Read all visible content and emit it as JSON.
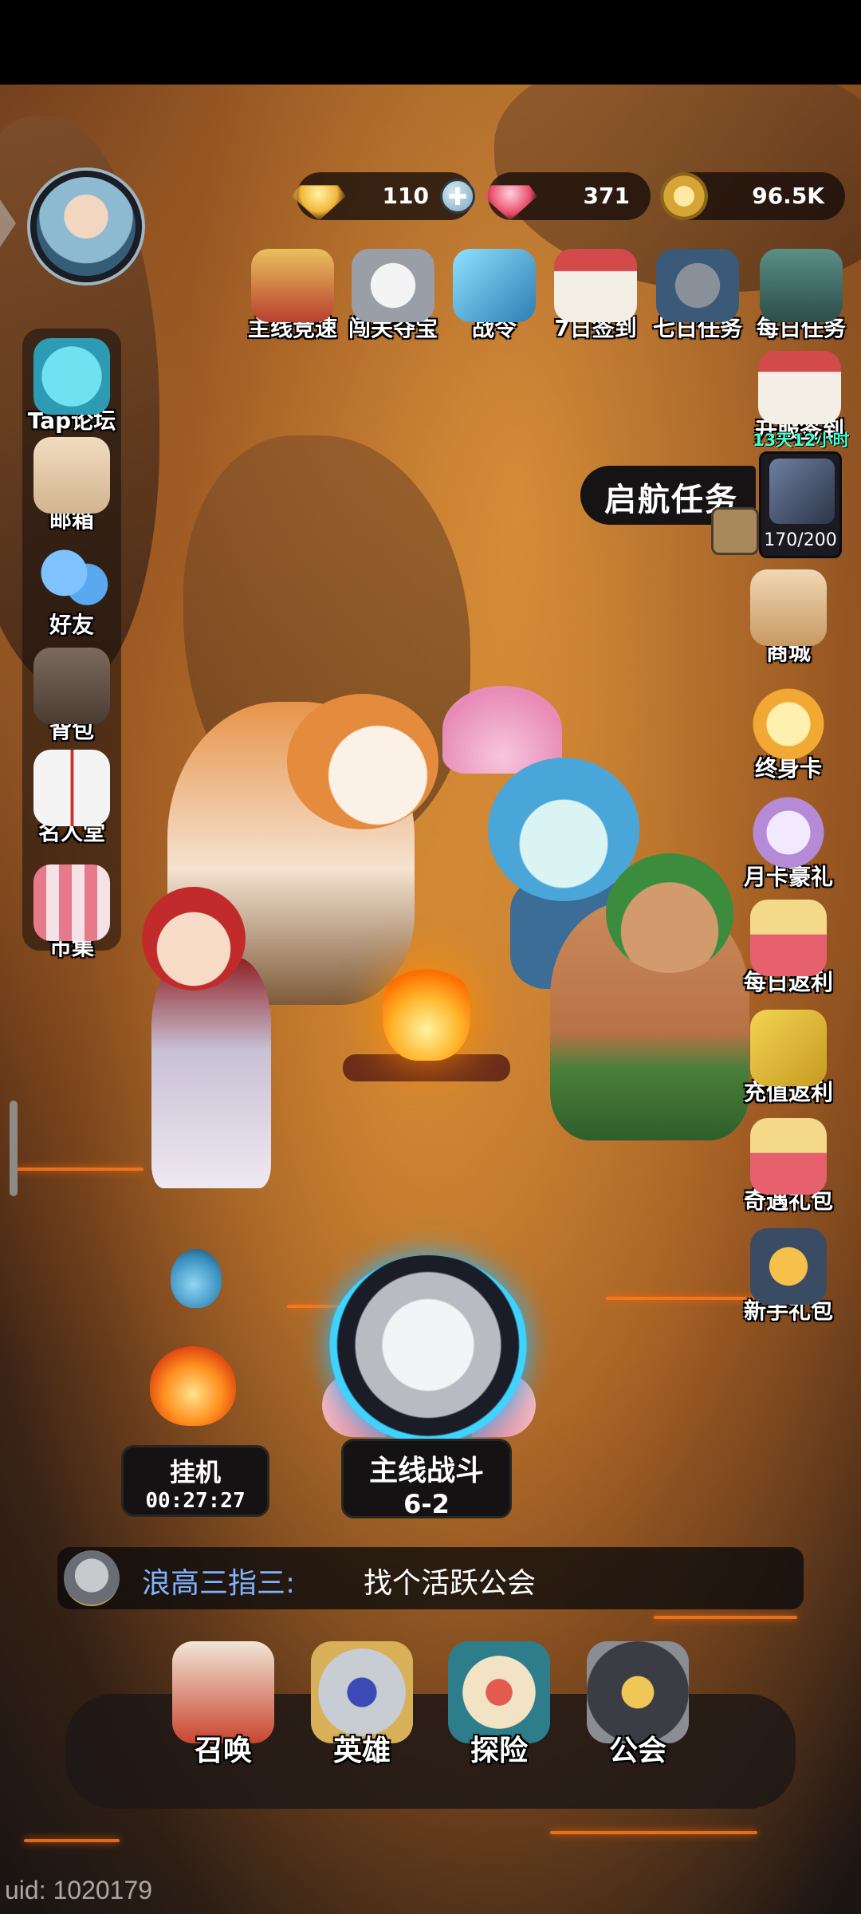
{
  "currency": {
    "gold_gems": "110",
    "pink_gems": "371",
    "coins": "96.5K"
  },
  "colors": {
    "accent_blue": "#3fd3ff",
    "countdown_teal": "#46ffd2",
    "chat_name_blue": "#7fb2ff"
  },
  "top_icons": [
    {
      "label": "主线竞速",
      "icon": "trophy-shield-icon"
    },
    {
      "label": "闯关夺宝",
      "icon": "wolf-crest-icon"
    },
    {
      "label": "战令",
      "icon": "feather-pass-icon"
    },
    {
      "label": "7日签到",
      "icon": "calendar-5-icon"
    },
    {
      "label": "七日任务",
      "icon": "helmet-icon"
    },
    {
      "label": "每日任务",
      "icon": "quest-board-icon"
    }
  ],
  "server_signin": {
    "label": "开服签到",
    "countdown": "13天12小时",
    "icon": "calendar-10-icon"
  },
  "mission": {
    "title": "启航任务",
    "progress": "170/200"
  },
  "left_menu": [
    {
      "label": "Tap论坛",
      "icon": "chat-bubble-icon"
    },
    {
      "label": "邮箱",
      "icon": "mail-icon"
    },
    {
      "label": "好友",
      "icon": "friends-icon"
    },
    {
      "label": "背包",
      "icon": "backpack-icon"
    },
    {
      "label": "名人堂",
      "icon": "hall-of-fame-icon"
    },
    {
      "label": "市集",
      "icon": "market-stall-icon"
    }
  ],
  "right_menu": [
    {
      "label": "商城",
      "icon": "shop-bag-icon"
    },
    {
      "label": "终身卡",
      "icon": "crown-icon"
    },
    {
      "label": "月卡豪礼",
      "icon": "ssr-card-icon"
    },
    {
      "label": "每日返利",
      "icon": "popcorn-gift-icon"
    },
    {
      "label": "充值返利",
      "icon": "match-ticket-icon"
    },
    {
      "label": "奇遇礼包",
      "icon": "popcorn-gift-icon"
    },
    {
      "label": "新手礼包",
      "icon": "gold-chest-icon"
    }
  ],
  "idle": {
    "label": "挂机",
    "time": "00:27:27"
  },
  "battle": {
    "label": "主线战斗",
    "stage": "6-2"
  },
  "chat": {
    "name": "浪高三指三:",
    "message": "找个活跃公会"
  },
  "bottom_nav": [
    {
      "label": "召唤",
      "icon": "summon-helmet-icon"
    },
    {
      "label": "英雄",
      "icon": "hero-helmet-icon"
    },
    {
      "label": "探险",
      "icon": "compass-icon"
    },
    {
      "label": "公会",
      "icon": "guild-star-icon"
    }
  ],
  "uid": "uid: 1020179"
}
